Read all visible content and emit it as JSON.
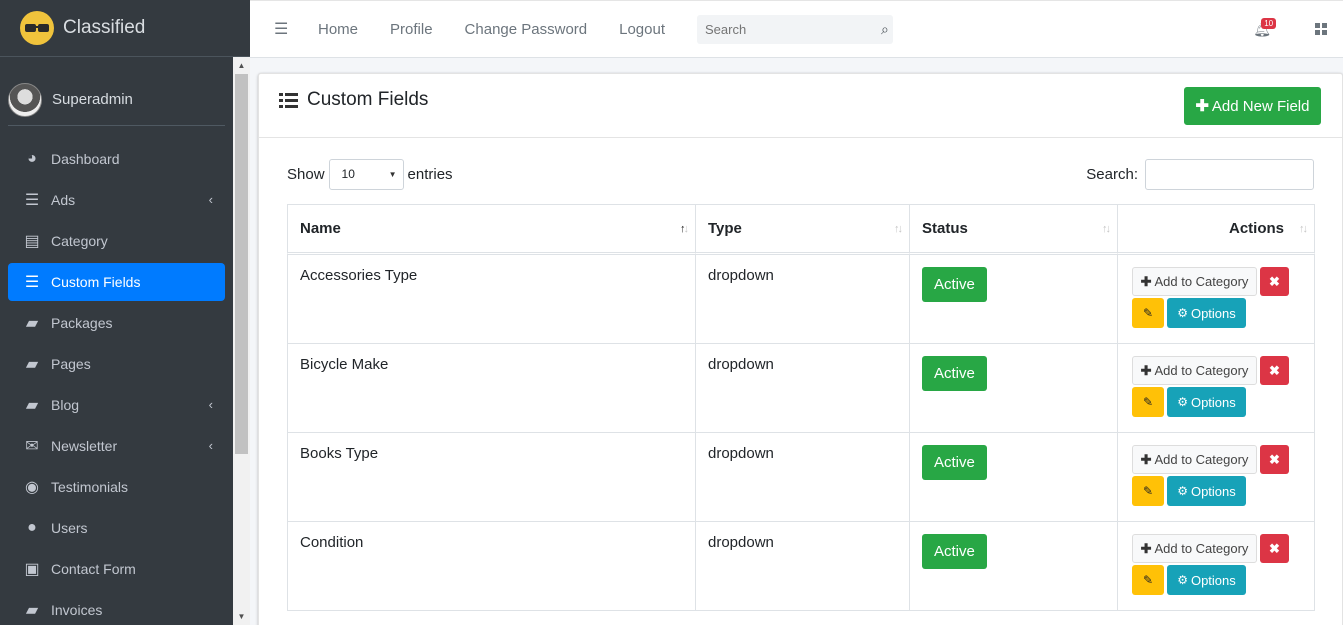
{
  "brand": {
    "name": "Classified"
  },
  "user": {
    "name": "Superadmin"
  },
  "sidebar": {
    "items": [
      {
        "label": "Dashboard",
        "icon": "dashboard-icon",
        "glyph": "◕",
        "chevron": false,
        "active": false
      },
      {
        "label": "Ads",
        "icon": "bars-icon",
        "glyph": "☰",
        "chevron": true,
        "active": false
      },
      {
        "label": "Category",
        "icon": "list-icon",
        "glyph": "▤",
        "chevron": false,
        "active": false
      },
      {
        "label": "Custom Fields",
        "icon": "bars-icon",
        "glyph": "☰",
        "chevron": false,
        "active": true
      },
      {
        "label": "Packages",
        "icon": "book-icon",
        "glyph": "▰",
        "chevron": false,
        "active": false
      },
      {
        "label": "Pages",
        "icon": "book-icon",
        "glyph": "▰",
        "chevron": false,
        "active": false
      },
      {
        "label": "Blog",
        "icon": "book-icon",
        "glyph": "▰",
        "chevron": true,
        "active": false
      },
      {
        "label": "Newsletter",
        "icon": "envelope-icon",
        "glyph": "✉",
        "chevron": true,
        "active": false
      },
      {
        "label": "Testimonials",
        "icon": "users-icon",
        "glyph": "◉",
        "chevron": false,
        "active": false
      },
      {
        "label": "Users",
        "icon": "user-icon",
        "glyph": "●",
        "chevron": false,
        "active": false
      },
      {
        "label": "Contact Form",
        "icon": "address-card-icon",
        "glyph": "▣",
        "chevron": false,
        "active": false
      },
      {
        "label": "Invoices",
        "icon": "book-icon",
        "glyph": "▰",
        "chevron": false,
        "active": false
      }
    ]
  },
  "topnav": {
    "links": [
      "Home",
      "Profile",
      "Change Password",
      "Logout"
    ],
    "search_placeholder": "Search",
    "notification_count": "10"
  },
  "page": {
    "title": "Custom Fields",
    "add_button": "Add New Field"
  },
  "table_controls": {
    "show_label": "Show",
    "entries_value": "10",
    "entries_label": "entries",
    "search_label": "Search:"
  },
  "table": {
    "columns": [
      "Name",
      "Type",
      "Status",
      "Actions"
    ],
    "rows": [
      {
        "name": "Accessories Type",
        "type": "dropdown",
        "status": "Active"
      },
      {
        "name": "Bicycle Make",
        "type": "dropdown",
        "status": "Active"
      },
      {
        "name": "Books Type",
        "type": "dropdown",
        "status": "Active"
      },
      {
        "name": "Condition",
        "type": "dropdown",
        "status": "Active"
      }
    ],
    "action_labels": {
      "add_to_category": "Add to Category",
      "options": "Options"
    }
  },
  "colors": {
    "sidebar_bg": "#343a40",
    "active_blue": "#007bff",
    "success": "#28a745",
    "danger": "#dc3545",
    "warning": "#ffc107",
    "info": "#17a2b8"
  }
}
